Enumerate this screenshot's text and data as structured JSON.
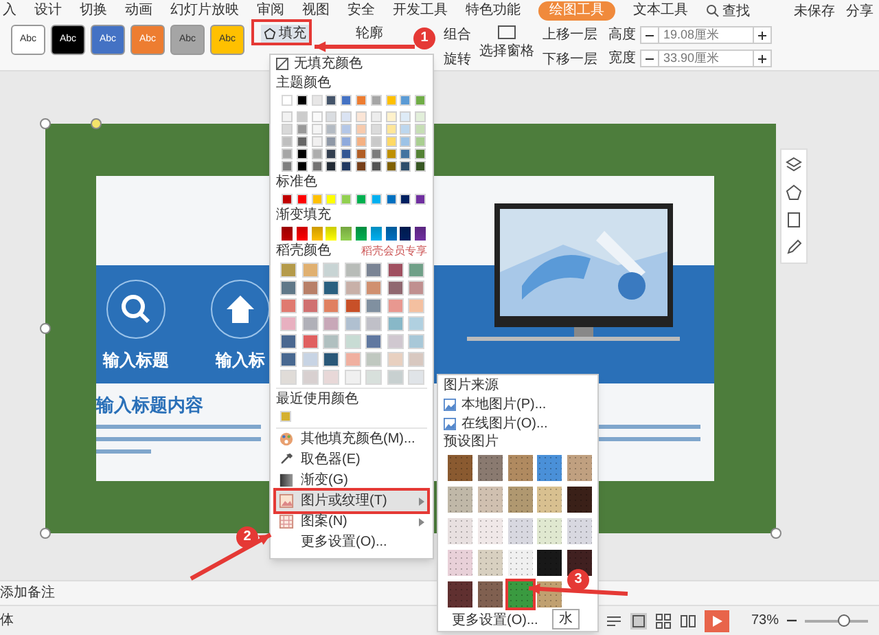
{
  "ribbon_tabs": [
    {
      "label": "入",
      "selected": false
    },
    {
      "label": "设计",
      "selected": false
    },
    {
      "label": "切换",
      "selected": false
    },
    {
      "label": "动画",
      "selected": false
    },
    {
      "label": "幻灯片放映",
      "selected": false
    },
    {
      "label": "审阅",
      "selected": false
    },
    {
      "label": "视图",
      "selected": false
    },
    {
      "label": "安全",
      "selected": false
    },
    {
      "label": "开发工具",
      "selected": false
    },
    {
      "label": "特色功能",
      "selected": false
    },
    {
      "label": "绘图工具",
      "selected": true
    },
    {
      "label": "文本工具",
      "selected": false
    }
  ],
  "search": {
    "label": "查找"
  },
  "top_right": {
    "save_status": "未保存",
    "share": "分享"
  },
  "shape_styles": [
    {
      "label": "Abc",
      "color": "#ffffff"
    },
    {
      "label": "Abc",
      "color": "#000000"
    },
    {
      "label": "Abc",
      "color": "#4472c4"
    },
    {
      "label": "Abc",
      "color": "#ed7d31"
    },
    {
      "label": "Abc",
      "color": "#a5a5a5"
    },
    {
      "label": "Abc",
      "color": "#ffc000"
    }
  ],
  "toolbar": {
    "fill": "填充",
    "outline": "轮廓",
    "group": "组合",
    "rotate": "旋转",
    "selection_pane": "选择窗格",
    "bring_forward": "上移一层",
    "send_backward": "下移一层",
    "height_label": "高度",
    "height_value": "19.08厘米",
    "width_label": "宽度",
    "width_value": "33.90厘米"
  },
  "fill_menu": {
    "no_fill": "无填充颜色",
    "theme_header": "主题颜色",
    "theme_colors": [
      {
        "color": "#ffffff"
      },
      {
        "color": "#000000"
      },
      {
        "color": "#e7e6e6"
      },
      {
        "color": "#44546a"
      },
      {
        "color": "#4472c4"
      },
      {
        "color": "#ed7d31"
      },
      {
        "color": "#a5a5a5"
      },
      {
        "color": "#ffc000"
      },
      {
        "color": "#5b9bd5"
      },
      {
        "color": "#70ad47"
      }
    ],
    "standard_header": "标准色",
    "standard_colors": [
      {
        "color": "#c00000"
      },
      {
        "color": "#ff0000"
      },
      {
        "color": "#ffc000"
      },
      {
        "color": "#ffff00"
      },
      {
        "color": "#92d050"
      },
      {
        "color": "#00b050"
      },
      {
        "color": "#00b0f0"
      },
      {
        "color": "#0070c0"
      },
      {
        "color": "#002060"
      },
      {
        "color": "#7030a0"
      }
    ],
    "gradient_header": "渐变填充",
    "docer_header": "稻壳颜色",
    "docer_badge": "稻壳会员专享",
    "docer_colors": [
      {
        "color": "#b49a4a"
      },
      {
        "color": "#e0b070"
      },
      {
        "color": "#c8d4d4"
      },
      {
        "color": "#b8bcb8"
      },
      {
        "color": "#7a8494"
      },
      {
        "color": "#a05060"
      },
      {
        "color": "#70a088"
      },
      {
        "color": "#607888"
      },
      {
        "color": "#b88068"
      },
      {
        "color": "#2a6080"
      },
      {
        "color": "#c8b0a8"
      },
      {
        "color": "#d09070"
      },
      {
        "color": "#906870"
      },
      {
        "color": "#c09090"
      },
      {
        "color": "#e07a70"
      },
      {
        "color": "#d07070"
      },
      {
        "color": "#e08060"
      },
      {
        "color": "#c85028"
      },
      {
        "color": "#8090a0"
      },
      {
        "color": "#e89890"
      },
      {
        "color": "#f4c0a0"
      },
      {
        "color": "#e8b0c0"
      },
      {
        "color": "#b0b0b8"
      },
      {
        "color": "#c8a8b8"
      },
      {
        "color": "#b0c0d0"
      },
      {
        "color": "#c0c0c8"
      },
      {
        "color": "#88b8c8"
      },
      {
        "color": "#b0d0e0"
      },
      {
        "color": "#4a6890"
      },
      {
        "color": "#e06060"
      },
      {
        "color": "#b0c0c0"
      },
      {
        "color": "#c8dcd4"
      },
      {
        "color": "#6078a0"
      },
      {
        "color": "#d0c8d0"
      },
      {
        "color": "#a8c8d8"
      },
      {
        "color": "#486890"
      },
      {
        "color": "#c8d4e4"
      },
      {
        "color": "#2a5878"
      },
      {
        "color": "#f0b0a0"
      },
      {
        "color": "#c0c8c0"
      },
      {
        "color": "#e8d0c0"
      },
      {
        "color": "#d8c8c0"
      },
      {
        "color": "#e0dcd8"
      },
      {
        "color": "#d8d0d0"
      },
      {
        "color": "#e8d8d8"
      },
      {
        "color": "#f0f0f0"
      },
      {
        "color": "#d8e0dc"
      },
      {
        "color": "#c8d0d0"
      },
      {
        "color": "#e0e4e8"
      }
    ],
    "recent_header": "最近使用颜色",
    "recent_colors": [
      {
        "color": "#d4b030"
      }
    ],
    "items": [
      {
        "label": "其他填充颜色(M)...",
        "selected": false,
        "submenu": false
      },
      {
        "label": "取色器(E)",
        "selected": false,
        "submenu": false
      },
      {
        "label": "渐变(G)",
        "selected": false,
        "submenu": false
      },
      {
        "label": "图片或纹理(T)",
        "selected": true,
        "submenu": true
      },
      {
        "label": "图案(N)",
        "selected": false,
        "submenu": true
      },
      {
        "label": "更多设置(O)...",
        "selected": false,
        "submenu": false
      }
    ]
  },
  "texture_menu": {
    "source_header": "图片来源",
    "local": "本地图片(P)...",
    "online": "在线图片(O)...",
    "preset_header": "预设图片",
    "textures": [
      {
        "color": "#8a5a30",
        "selected": false
      },
      {
        "color": "#8a7a70",
        "selected": false
      },
      {
        "color": "#b08a60",
        "selected": false
      },
      {
        "color": "#4a90d8",
        "selected": false
      },
      {
        "color": "#c0a080",
        "selected": false
      },
      {
        "color": "#c0b8a8",
        "selected": false
      },
      {
        "color": "#d0c0b0",
        "selected": false
      },
      {
        "color": "#b09870",
        "selected": false
      },
      {
        "color": "#d8c090",
        "selected": false
      },
      {
        "color": "#3a2018",
        "selected": false
      },
      {
        "color": "#e8e0e0",
        "selected": false
      },
      {
        "color": "#f0e8e8",
        "selected": false
      },
      {
        "color": "#d8d8e0",
        "selected": false
      },
      {
        "color": "#e0e8d0",
        "selected": false
      },
      {
        "color": "#d8d8e0",
        "selected": false
      },
      {
        "color": "#e8d0d8",
        "selected": false
      },
      {
        "color": "#d8d0c0",
        "selected": false
      },
      {
        "color": "#f0f0f0",
        "selected": false
      },
      {
        "color": "#181818",
        "selected": false
      },
      {
        "color": "#402020",
        "selected": false
      },
      {
        "color": "#603030",
        "selected": false
      },
      {
        "color": "#806050",
        "selected": false
      },
      {
        "color": "#3a9a40",
        "selected": true
      },
      {
        "color": "#c0a070",
        "selected": false
      }
    ],
    "more": "更多设置(O)..."
  },
  "tooltip": "水",
  "annotations": [
    {
      "number": "1"
    },
    {
      "number": "2"
    },
    {
      "number": "3"
    }
  ],
  "slide": {
    "feature_titles": [
      "输入标题",
      "输入标"
    ],
    "heading": "输入标题内容"
  },
  "notes": "添加备注",
  "status_left": "体",
  "zoom": {
    "reading": "73%",
    "level": 0.6
  }
}
